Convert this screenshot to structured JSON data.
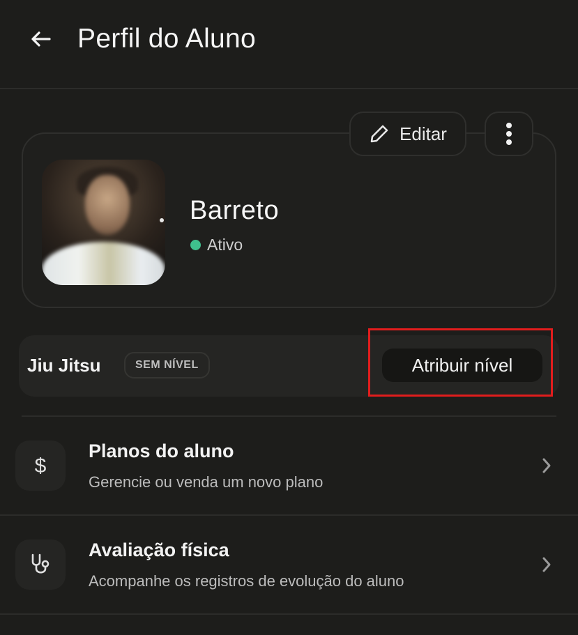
{
  "header": {
    "title": "Perfil do Aluno"
  },
  "profile": {
    "edit_label": "Editar",
    "name": "Barreto",
    "status": "Ativo",
    "status_color": "#3fc08d"
  },
  "level": {
    "modality": "Jiu Jitsu",
    "badge": "SEM NÍVEL",
    "assign_label": "Atribuir nível",
    "highlight_color": "#e11d1d"
  },
  "menu": {
    "items": [
      {
        "title": "Planos do aluno",
        "subtitle": "Gerencie ou venda um novo plano",
        "icon": "dollar-icon"
      },
      {
        "title": "Avaliação física",
        "subtitle": "Acompanhe os registros de evolução do aluno",
        "icon": "stethoscope-icon"
      }
    ]
  }
}
